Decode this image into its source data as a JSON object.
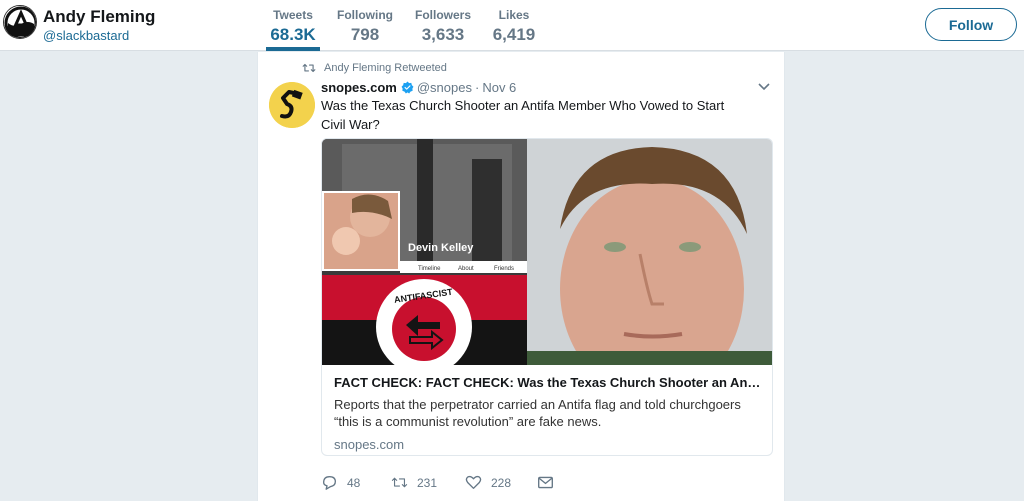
{
  "profile": {
    "name": "Andy Fleming",
    "handle": "@slackbastard",
    "avatar_icon": "anarchist-circle-a-icon"
  },
  "stats": [
    {
      "label": "Tweets",
      "value": "68.3K",
      "active": true
    },
    {
      "label": "Following",
      "value": "798"
    },
    {
      "label": "Followers",
      "value": "3,633"
    },
    {
      "label": "Likes",
      "value": "6,419"
    }
  ],
  "follow_button": "Follow",
  "tweet": {
    "retweeted_by": "Andy Fleming Retweeted",
    "author": "snopes.com",
    "handle": "@snopes",
    "separator": "·",
    "date": "Nov 6",
    "text": "Was the Texas Church Shooter an Antifa Member Who Vowed to Start Civil War?",
    "card": {
      "image_labels": {
        "name": "Devin Kelley",
        "timeline": "Timeline",
        "about": "About",
        "friends": "Friends",
        "flag_text": "ANTIFASCIST"
      },
      "title": "FACT CHECK: FACT CHECK: Was the Texas Church Shooter an Antif...",
      "description": "Reports that the perpetrator carried an Antifa flag and told churchgoers “this is a communist revolution” are fake news.",
      "domain": "snopes.com"
    },
    "actions": {
      "replies": "48",
      "retweets": "231",
      "likes": "228"
    }
  },
  "colors": {
    "link": "#1b6a94",
    "muted": "#657786",
    "background": "#e6ecf0",
    "verified": "#1da1f2",
    "flag_red": "#c8102e",
    "snopes_yellow": "#f3d24c"
  }
}
